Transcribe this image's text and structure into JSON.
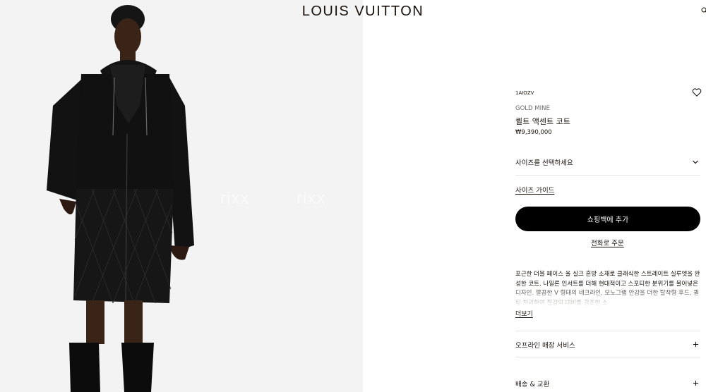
{
  "header": {
    "brand": "LOUIS VUITTON"
  },
  "gallery": {
    "watermark_1": "rixx",
    "watermark_2": "rixx"
  },
  "product": {
    "ref": "1AIOZV",
    "collection": "GOLD MINE",
    "name": "퀼트 액센트 코트",
    "price": "₩9,390,000",
    "size_select_label": "사이즈를 선택하세요",
    "size_guide": "사이즈 가이드",
    "add_to_bag": "쇼핑백에 추가",
    "order_by_phone": "전화로 주문",
    "description": "포근한 더블 페이스 울 실크 혼방 소재로 클래식한 스트레이트 실루엣을 완성한 코트. 나일론 인서트를 더해 현대적이고 스포티한 분위기를 불어넣은 디자인. 깔끔한 V 형태의 네크라인, 모노그램 안감을 더한 탈착형 후드, 퀼팅 처리하여 질감의 대비를 강조한 소",
    "read_more": "더보기",
    "accordion": [
      {
        "label": "오프라인 매장 서비스"
      },
      {
        "label": "배송 & 교환"
      }
    ]
  },
  "icons": {
    "wishlist": "heart-icon",
    "size_select": "chevron-down-icon",
    "accordion": "plus-icon",
    "header_right": "search-icon"
  },
  "colors": {
    "text": "#19110b",
    "button": "#000000",
    "photo_background": "#f3f3f3",
    "muted": "#6b6b6b"
  }
}
